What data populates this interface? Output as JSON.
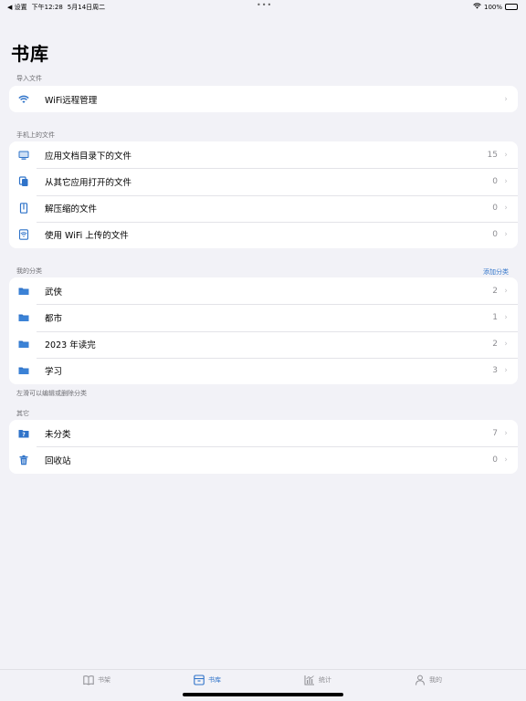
{
  "status_bar": {
    "back_label": "◀ 设置",
    "time": "下午12:28",
    "date": "5月14日周二",
    "dots": "•••",
    "battery_pct": "100%",
    "battery_level": 1.0
  },
  "page": {
    "title": "书库"
  },
  "sections": {
    "import": {
      "header": "导入文件",
      "items": [
        {
          "label": "WiFi远程管理",
          "icon": "wifi-icon",
          "count": ""
        }
      ]
    },
    "device_files": {
      "header": "手机上的文件",
      "items": [
        {
          "label": "应用文档目录下的文件",
          "icon": "monitor-icon",
          "count": "15"
        },
        {
          "label": "从其它应用打开的文件",
          "icon": "copy-files-icon",
          "count": "0"
        },
        {
          "label": "解压缩的文件",
          "icon": "archive-icon",
          "count": "0"
        },
        {
          "label": "使用 WiFi 上传的文件",
          "icon": "wifi-file-icon",
          "count": "0"
        }
      ]
    },
    "categories": {
      "header": "我的分类",
      "action": "添加分类",
      "footer": "左滑可以编辑或删除分类",
      "items": [
        {
          "label": "武侠",
          "icon": "folder-icon",
          "count": "2"
        },
        {
          "label": "都市",
          "icon": "folder-icon",
          "count": "1"
        },
        {
          "label": "2023 年读完",
          "icon": "folder-icon",
          "count": "2"
        },
        {
          "label": "学习",
          "icon": "folder-icon",
          "count": "3"
        }
      ]
    },
    "other": {
      "header": "其它",
      "items": [
        {
          "label": "未分类",
          "icon": "question-folder-icon",
          "count": "7"
        },
        {
          "label": "回收站",
          "icon": "trash-icon",
          "count": "0"
        }
      ]
    }
  },
  "tab_bar": {
    "tabs": [
      {
        "label": "书架",
        "icon": "book-icon",
        "active": false
      },
      {
        "label": "书库",
        "icon": "archive-box-icon",
        "active": true
      },
      {
        "label": "统计",
        "icon": "chart-icon",
        "active": false
      },
      {
        "label": "我的",
        "icon": "person-icon",
        "active": false
      }
    ]
  },
  "colors": {
    "accent": "#2f73c9",
    "background": "#f2f2f7",
    "secondary_text": "#8e8e93"
  }
}
